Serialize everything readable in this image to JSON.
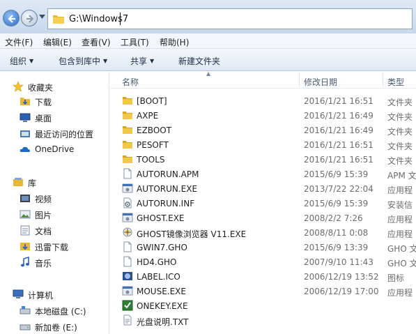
{
  "address": {
    "path": "G:\\Windows7"
  },
  "menu": [
    "文件(F)",
    "编辑(E)",
    "查看(V)",
    "工具(T)",
    "帮助(H)"
  ],
  "toolbar": {
    "organize": "组织",
    "include_library": "包含到库中",
    "share": "共享",
    "new_folder": "新建文件夹"
  },
  "sidebar": {
    "favorites": {
      "header": "收藏夹",
      "items": [
        "下载",
        "桌面",
        "最近访问的位置"
      ]
    },
    "onedrive": "OneDrive",
    "libraries": {
      "header": "库",
      "items": [
        "视频",
        "图片",
        "文档",
        "迅雷下载",
        "音乐"
      ]
    },
    "computer": {
      "header": "计算机",
      "items": [
        "本地磁盘 (C:)",
        "新加卷 (E:)"
      ]
    }
  },
  "columns": {
    "name": "名称",
    "date": "修改日期",
    "type": "类型"
  },
  "files": [
    {
      "name": "[BOOT]",
      "date": "2016/1/21 16:51",
      "type": "文件夹",
      "icon": "folder-icon"
    },
    {
      "name": "AXPE",
      "date": "2016/1/21 16:49",
      "type": "文件夹",
      "icon": "folder-icon"
    },
    {
      "name": "EZBOOT",
      "date": "2016/1/21 16:49",
      "type": "文件夹",
      "icon": "folder-icon"
    },
    {
      "name": "PESOFT",
      "date": "2016/1/21 16:51",
      "type": "文件夹",
      "icon": "folder-icon"
    },
    {
      "name": "TOOLS",
      "date": "2016/1/21 16:51",
      "type": "文件夹",
      "icon": "folder-icon"
    },
    {
      "name": "AUTORUN.APM",
      "date": "2015/6/9 15:39",
      "type": "APM 文",
      "icon": "file-icon"
    },
    {
      "name": "AUTORUN.EXE",
      "date": "2013/7/22 22:04",
      "type": "应用程",
      "icon": "exe-icon"
    },
    {
      "name": "AUTORUN.INF",
      "date": "2015/6/9 15:39",
      "type": "安装信",
      "icon": "inf-icon"
    },
    {
      "name": "GHOST.EXE",
      "date": "2008/2/2 7:26",
      "type": "应用程",
      "icon": "exe-icon"
    },
    {
      "name": "GHOST镜像浏览器 V11.EXE",
      "date": "2008/8/11 0:08",
      "type": "应用程",
      "icon": "ghost-icon"
    },
    {
      "name": "GWIN7.GHO",
      "date": "2015/6/9 13:39",
      "type": "GHO 文",
      "icon": "file-icon"
    },
    {
      "name": "HD4.GHO",
      "date": "2007/9/10 11:43",
      "type": "GHO 文",
      "icon": "file-icon"
    },
    {
      "name": "LABEL.ICO",
      "date": "2006/12/19 13:52",
      "type": "图标",
      "icon": "ico-icon"
    },
    {
      "name": "MOUSE.EXE",
      "date": "2006/12/19 17:00",
      "type": "应用程",
      "icon": "exe-icon"
    },
    {
      "name": "ONEKEY.EXE",
      "date": "",
      "type": "",
      "icon": "onekey-icon"
    },
    {
      "name": "光盘说明.TXT",
      "date": "",
      "type": "",
      "icon": "txt-icon"
    }
  ],
  "colors": {
    "folder": "#e8b830",
    "chrome": "#dfe9f5",
    "secondary_text": "#6d6d6d"
  }
}
